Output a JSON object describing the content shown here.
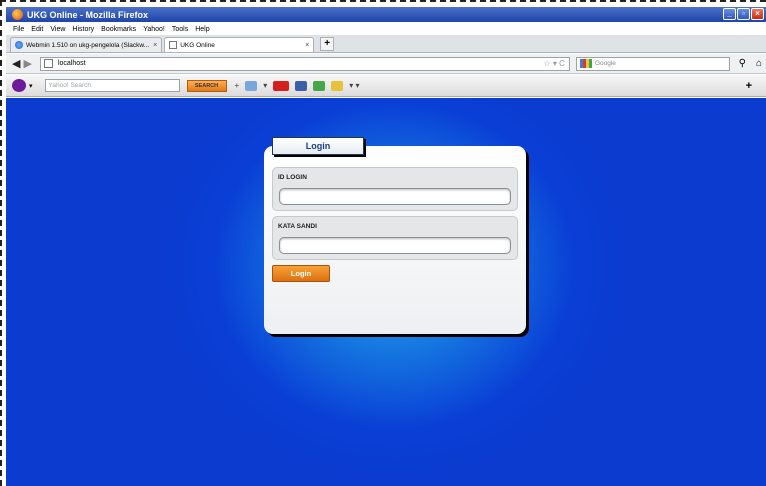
{
  "window": {
    "title": "UKG Online - Mozilla Firefox"
  },
  "menu": [
    "File",
    "Edit",
    "View",
    "History",
    "Bookmarks",
    "Yahoo!",
    "Tools",
    "Help"
  ],
  "tabs": [
    {
      "label": "Webmin 1.510 on ukg-pengelola (Slackw...",
      "close": "×"
    },
    {
      "label": "UKG Online",
      "close": "×"
    }
  ],
  "nav": {
    "url": "localhost",
    "search_engine": "Google"
  },
  "yahoo": {
    "search_placeholder": "Yahoo! Search",
    "search_button": "SEARCH"
  },
  "login": {
    "tab_title": "Login",
    "id_label": "ID LOGIN",
    "id_value": "",
    "password_label": "KATA SANDI",
    "password_value": "",
    "button_label": "Login"
  },
  "colors": {
    "background": "#0b3bcf",
    "button": "#e8801a"
  }
}
